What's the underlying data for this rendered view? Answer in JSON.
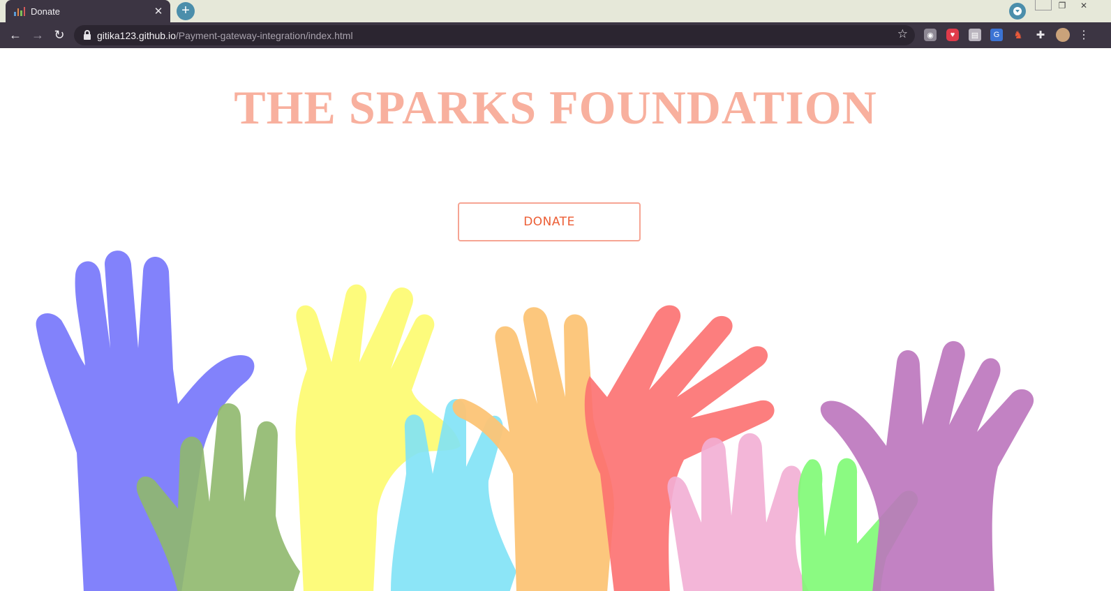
{
  "browser": {
    "tab_title": "Donate",
    "tab_close": "✕",
    "new_tab": "+",
    "url_host": "gitika123.github.io",
    "url_path": "/Payment-gateway-integration/index.html"
  },
  "page": {
    "headline": "THE SPARKS FOUNDATION",
    "donate_label": "DONATE"
  },
  "colors": {
    "headline": "#f8b09e",
    "button_border": "#f6a493",
    "button_text": "#ec5d34",
    "chrome_dark": "#3c3543",
    "tabbar": "#e6e8d9"
  },
  "illustration": {
    "hands": [
      {
        "name": "blue-hand",
        "color": "#7b7bfb"
      },
      {
        "name": "green-hand",
        "color": "#8fb86d"
      },
      {
        "name": "yellow-hand",
        "color": "#fdfb6e"
      },
      {
        "name": "cyan-hand",
        "color": "#7fe2f6"
      },
      {
        "name": "orange-hand",
        "color": "#fcc476"
      },
      {
        "name": "red-hand",
        "color": "#fc7070"
      },
      {
        "name": "pink-hand",
        "color": "#f2aed4"
      },
      {
        "name": "lime-hand",
        "color": "#7efa74"
      },
      {
        "name": "purple-hand",
        "color": "#bb74bd"
      }
    ]
  }
}
